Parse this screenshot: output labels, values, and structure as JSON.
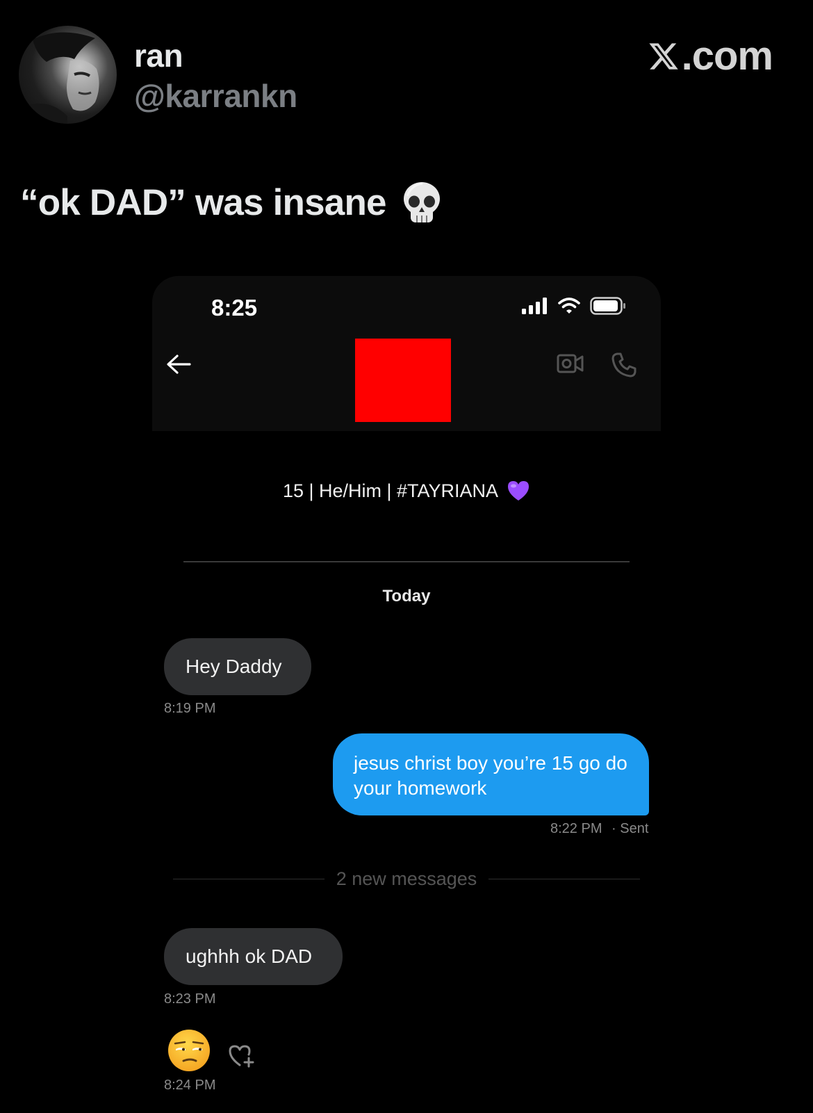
{
  "tweet": {
    "author_name": "ran",
    "author_handle": "@karrankn",
    "site_logo_text": ".com",
    "text": "“ok DAD” was insane",
    "text_emoji": "skull-emoji"
  },
  "dm_screenshot": {
    "status_bar": {
      "time": "8:25",
      "icons": [
        "signal-icon",
        "wifi-icon",
        "battery-icon"
      ]
    },
    "header": {
      "back_icon": "arrow-left-icon",
      "video_call_icon": "video-camera-icon",
      "voice_call_icon": "phone-icon",
      "redaction_color": "#ff0000"
    },
    "profile_bio": "15 | He/Him | #TAYRIANA",
    "bio_emoji": "purple-heart-emoji",
    "date_separator": "Today",
    "messages": [
      {
        "direction": "incoming",
        "text": "Hey Daddy",
        "time": "8:19 PM"
      },
      {
        "direction": "outgoing",
        "text": "jesus christ boy you’re 15 go do your homework",
        "time": "8:22 PM",
        "status": "· Sent"
      },
      {
        "direction": "incoming",
        "text": "ughhh ok DAD",
        "time": "8:23 PM"
      },
      {
        "direction": "incoming",
        "emoji": "unamused-face-emoji",
        "time": "8:24 PM"
      }
    ],
    "new_messages_label": "2 new messages",
    "react_icon": "heart-plus-icon",
    "colors": {
      "incoming_bubble": "#2f3032",
      "outgoing_bubble": "#1d9bf0",
      "background": "#000000"
    }
  }
}
